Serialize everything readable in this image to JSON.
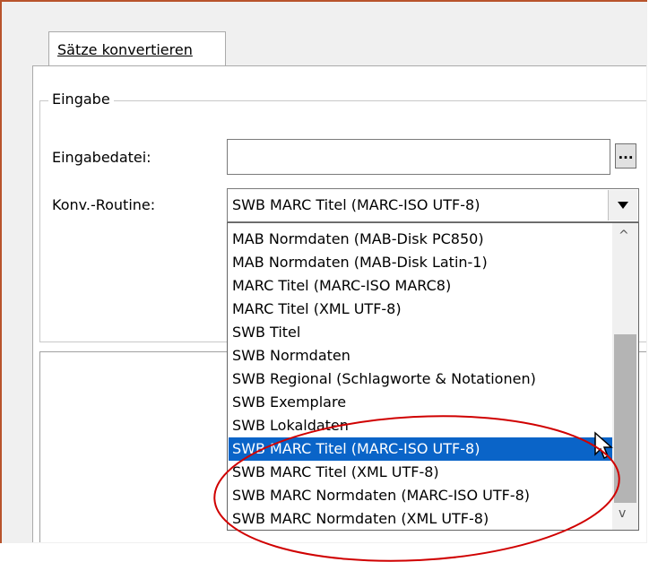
{
  "tab": {
    "label": "Sätze konvertieren"
  },
  "group": {
    "title": "Eingabe"
  },
  "fields": {
    "input_file_label": "Eingabedatei:",
    "input_file_value": "",
    "browse_label": "...",
    "routine_label": "Konv.-Routine:",
    "routine_value": "SWB MARC Titel (MARC-ISO UTF-8)"
  },
  "dropdown": {
    "options": [
      "MAB Normdaten (MAB-Disk PC850)",
      "MAB Normdaten (MAB-Disk Latin-1)",
      "MARC Titel (MARC-ISO MARC8)",
      "MARC Titel (XML UTF-8)",
      "SWB Titel",
      "SWB Normdaten",
      "SWB Regional (Schlagworte & Notationen)",
      "SWB Exemplare",
      "SWB Lokaldaten",
      "SWB MARC Titel (MARC-ISO UTF-8)",
      "SWB MARC Titel (XML UTF-8)",
      "SWB MARC Normdaten (MARC-ISO UTF-8)",
      "SWB MARC Normdaten (XML UTF-8)"
    ],
    "selected": "SWB MARC Titel (MARC-ISO UTF-8)",
    "up_arrow": "^",
    "down_arrow": "v"
  },
  "colors": {
    "selection": "#0a64c8",
    "annotation_circle": "#d00000",
    "window_border": "#b8542c"
  },
  "icons": {
    "browse": "ellipsis-icon",
    "cursor": "mouse-pointer-icon"
  }
}
